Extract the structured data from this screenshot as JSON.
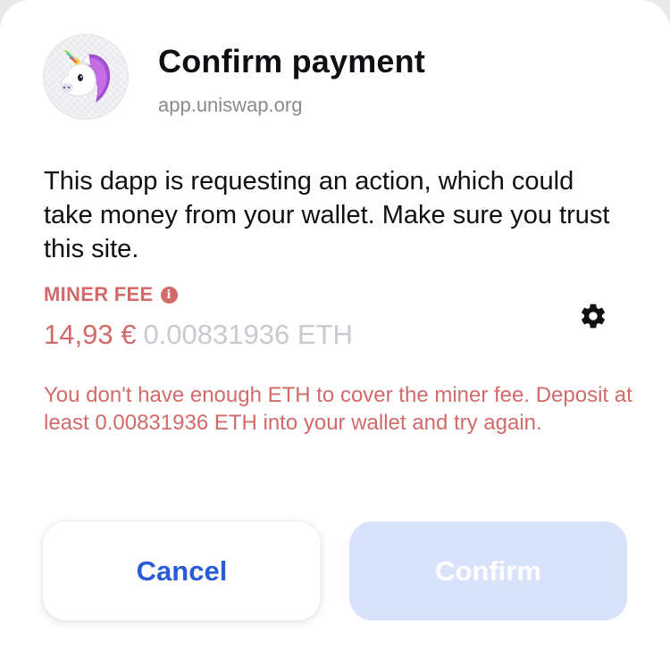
{
  "dialog": {
    "title": "Confirm payment",
    "origin": "app.uniswap.org",
    "description": "This dapp is requesting an action, which could take money from your wallet. Make sure you trust this site.",
    "dapp_icon": "unicorn-icon"
  },
  "fee": {
    "label": "MINER FEE",
    "info_icon": "i",
    "fiat_amount": "14,93 €",
    "crypto_amount": "0.00831936 ETH",
    "settings_icon": "gear-icon",
    "error_message": "You don't have enough ETH to cover the miner fee. Deposit at least 0.00831936 ETH into your wallet and try again."
  },
  "actions": {
    "cancel_label": "Cancel",
    "confirm_label": "Confirm",
    "confirm_disabled": true
  },
  "colors": {
    "accent": "#2a5bd7",
    "error": "#d26a6a",
    "disabled_button": "#d8e2fa",
    "text_primary": "#101014",
    "text_secondary": "#8a8a90"
  }
}
